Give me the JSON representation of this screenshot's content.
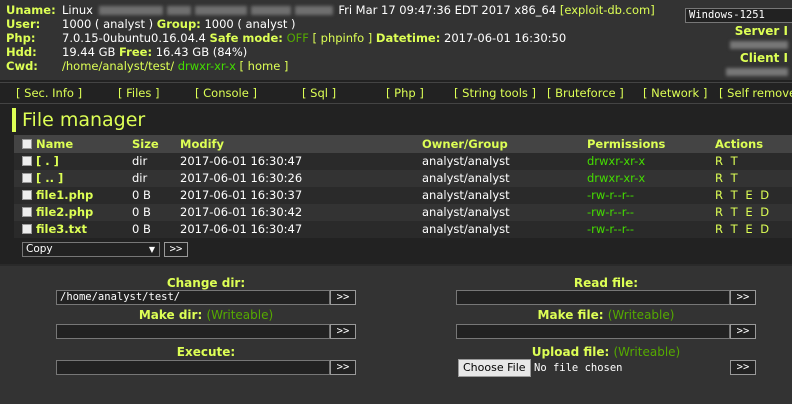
{
  "header": {
    "uname_label": "Uname:",
    "uname_prefix": "Linux",
    "uname_suffix": "Fri Mar 17 09:47:36 EDT 2017 x86_64",
    "uname_link": "[exploit-db.com]",
    "user_label": "User:",
    "user_value": "1000 ( analyst )",
    "group_label": "Group:",
    "group_value": "1000 ( analyst )",
    "php_label": "Php:",
    "php_value": "7.0.15-0ubuntu0.16.04.4",
    "safe_mode_label": "Safe mode:",
    "safe_mode_value": "OFF",
    "phpinfo_link": "[ phpinfo ]",
    "datetime_label": "Datetime:",
    "datetime_value": "2017-06-01 16:30:50",
    "hdd_label": "Hdd:",
    "hdd_value": "19.44 GB",
    "free_label": "Free:",
    "free_value": "16.43 GB (84%)",
    "cwd_label": "Cwd:",
    "cwd_path": "/home/analyst/test/",
    "cwd_perms": "drwxr-xr-x",
    "cwd_home": "[ home ]",
    "encoding": "Windows-1251",
    "server_ip_label": "Server I",
    "client_ip_label": "Client I"
  },
  "menu": [
    "[ Sec. Info ]",
    "[ Files ]",
    "[ Console ]",
    "[ Sql ]",
    "[ Php ]",
    "[ String tools ]",
    "[ Bruteforce ]",
    "[ Network ]",
    "[ Self remove"
  ],
  "file_manager": {
    "title": "File manager",
    "columns": {
      "name": "Name",
      "size": "Size",
      "modify": "Modify",
      "owner": "Owner/Group",
      "perms": "Permissions",
      "actions": "Actions"
    },
    "rows": [
      {
        "name": "[ . ]",
        "size": "dir",
        "modify": "2017-06-01 16:30:47",
        "owner": "analyst/analyst",
        "perms": "drwxr-xr-x",
        "actions": "R T"
      },
      {
        "name": "[ .. ]",
        "size": "dir",
        "modify": "2017-06-01 16:30:26",
        "owner": "analyst/analyst",
        "perms": "drwxr-xr-x",
        "actions": "R T"
      },
      {
        "name": "file1.php",
        "size": "0 B",
        "modify": "2017-06-01 16:30:37",
        "owner": "analyst/analyst",
        "perms": "-rw-r--r--",
        "actions": "R T E D"
      },
      {
        "name": "file2.php",
        "size": "0 B",
        "modify": "2017-06-01 16:30:42",
        "owner": "analyst/analyst",
        "perms": "-rw-r--r--",
        "actions": "R T E D"
      },
      {
        "name": "file3.txt",
        "size": "0 B",
        "modify": "2017-06-01 16:30:47",
        "owner": "analyst/analyst",
        "perms": "-rw-r--r--",
        "actions": "R T E D"
      }
    ],
    "bulk_action": "Copy",
    "go_label": ">>"
  },
  "forms": {
    "change_dir_label": "Change dir:",
    "change_dir_value": "/home/analyst/test/",
    "read_file_label": "Read file:",
    "read_file_value": "",
    "make_dir_label": "Make dir:",
    "make_file_label": "Make file:",
    "writeable": "(Writeable)",
    "make_dir_value": "",
    "make_file_value": "",
    "execute_label": "Execute:",
    "execute_value": "",
    "upload_file_label": "Upload file:",
    "choose_file": "Choose File",
    "no_file": "No file chosen",
    "submit": ">>"
  },
  "colors": {
    "accent": "#ddff55",
    "green": "#44dd00",
    "background": "#222222",
    "panel": "#333333"
  }
}
